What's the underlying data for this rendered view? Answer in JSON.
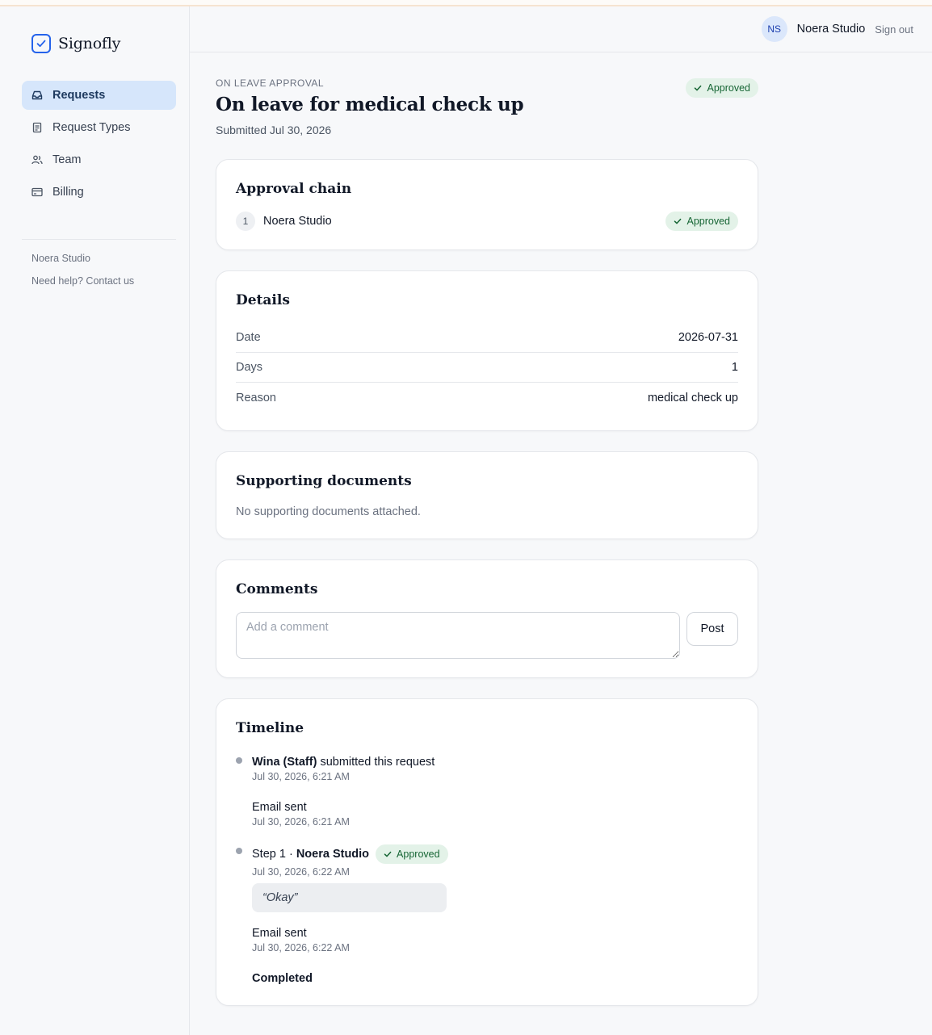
{
  "app": {
    "brand_name": "Signofly"
  },
  "sidebar": {
    "items": [
      {
        "label": "Requests",
        "icon": "inbox-icon",
        "active": true
      },
      {
        "label": "Request Types",
        "icon": "document-icon",
        "active": false
      },
      {
        "label": "Team",
        "icon": "users-icon",
        "active": false
      },
      {
        "label": "Billing",
        "icon": "credit-card-icon",
        "active": false
      }
    ],
    "org_name": "Noera Studio",
    "help_text": "Need help? Contact us"
  },
  "topbar": {
    "avatar_initials": "NS",
    "user_name": "Noera Studio",
    "sign_out_label": "Sign out"
  },
  "request": {
    "eyebrow": "On leave approval",
    "title": "On leave for medical check up",
    "submitted": "Submitted Jul 30, 2026",
    "status": "Approved"
  },
  "approval_chain": {
    "title": "Approval chain",
    "steps": [
      {
        "number": "1",
        "name": "Noera Studio",
        "status": "Approved"
      }
    ]
  },
  "details": {
    "title": "Details",
    "rows": [
      {
        "label": "Date",
        "value": "2026-07-31"
      },
      {
        "label": "Days",
        "value": "1"
      },
      {
        "label": "Reason",
        "value": "medical check up"
      }
    ]
  },
  "documents": {
    "title": "Supporting documents",
    "empty_text": "No supporting documents attached."
  },
  "comments": {
    "title": "Comments",
    "placeholder": "Add a comment",
    "post_label": "Post"
  },
  "timeline": {
    "title": "Timeline",
    "events": [
      {
        "actor": "Wina (Staff)",
        "text": " submitted this request",
        "time": "Jul 30, 2026, 6:21 AM"
      },
      {
        "text": "Email sent",
        "time": "Jul 30, 2026, 6:21 AM"
      },
      {
        "prefix": "Step 1 · ",
        "actor": "Noera Studio",
        "status": "Approved",
        "time": "Jul 30, 2026, 6:22 AM",
        "quote": "“Okay”"
      },
      {
        "text": "Email sent",
        "time": "Jul 30, 2026, 6:22 AM"
      },
      {
        "text": "Completed"
      }
    ]
  },
  "colors": {
    "accent": "#2563eb",
    "nav_active_bg": "#d6e6fb",
    "approved_bg": "#e3f2e8",
    "approved_text": "#166534"
  }
}
